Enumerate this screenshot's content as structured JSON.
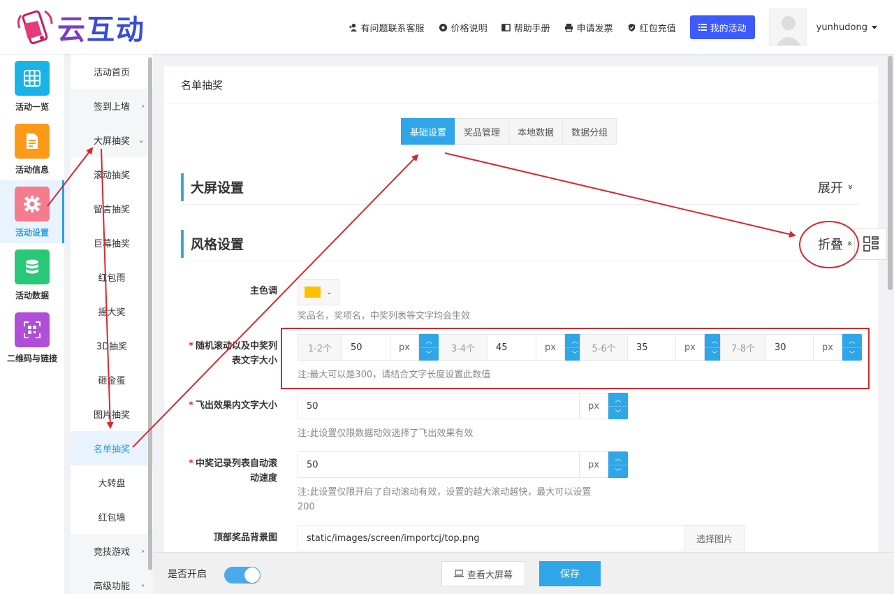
{
  "brand": {
    "logo_text_1": "云",
    "logo_text_2": "互动"
  },
  "top_nav": {
    "items": [
      {
        "label": "有问题联系客服",
        "icon": "add-user-icon"
      },
      {
        "label": "价格说明",
        "icon": "gear-icon"
      },
      {
        "label": "帮助手册",
        "icon": "book-icon"
      },
      {
        "label": "申请发票",
        "icon": "printer-icon"
      },
      {
        "label": "红包充值",
        "icon": "shield-check-icon"
      }
    ],
    "my_activity": "我的活动",
    "username": "yunhudong"
  },
  "iconbar": {
    "items": [
      {
        "label": "活动一览",
        "color": "#1ab3e8",
        "icon": "grid-icon"
      },
      {
        "label": "活动信息",
        "color": "#fd9a18",
        "icon": "document-icon"
      },
      {
        "label": "活动设置",
        "color": "#f47c8c",
        "icon": "gear-icon"
      },
      {
        "label": "活动数据",
        "color": "#28c878",
        "icon": "database-icon"
      },
      {
        "label": "二维码与链接",
        "color": "#b14ed8",
        "icon": "qrcode-icon"
      }
    ]
  },
  "submenu": {
    "items": [
      {
        "label": "活动首页",
        "arrow": ""
      },
      {
        "label": "签到上墙",
        "arrow": "›"
      },
      {
        "label": "大屏抽奖",
        "arrow": "⌄"
      },
      {
        "label": "滚动抽奖",
        "arrow": ""
      },
      {
        "label": "留言抽奖",
        "arrow": ""
      },
      {
        "label": "巨幕抽奖",
        "arrow": ""
      },
      {
        "label": "红包雨",
        "arrow": ""
      },
      {
        "label": "摇大奖",
        "arrow": ""
      },
      {
        "label": "3D抽奖",
        "arrow": ""
      },
      {
        "label": "砸金蛋",
        "arrow": ""
      },
      {
        "label": "图片抽奖",
        "arrow": ""
      },
      {
        "label": "名单抽奖",
        "arrow": ""
      },
      {
        "label": "大转盘",
        "arrow": ""
      },
      {
        "label": "红包墙",
        "arrow": ""
      },
      {
        "label": "竞技游戏",
        "arrow": "›"
      },
      {
        "label": "高级功能",
        "arrow": "›"
      }
    ]
  },
  "main": {
    "title": "名单抽奖",
    "tabs": [
      "基础设置",
      "奖品管理",
      "本地数据",
      "数据分组"
    ],
    "section_screen": {
      "title": "大屏设置",
      "toggle": "展开",
      "toggle_icon": "»"
    },
    "section_style": {
      "title": "风格设置",
      "toggle": "折叠",
      "toggle_icon": "»"
    },
    "primary_color": {
      "label": "主色调",
      "value": "#ffc000",
      "hint": "奖品名，奖项名，中奖列表等文字均会生效"
    },
    "random_font": {
      "req": "*",
      "label_l1": "随机滚动以及中奖列",
      "label_l2": "表文字大小",
      "groups": [
        {
          "prefix": "1-2个",
          "value": "50",
          "unit": "px"
        },
        {
          "prefix": "3-4个",
          "value": "45",
          "unit": "px"
        },
        {
          "prefix": "5-6个",
          "value": "35",
          "unit": "px"
        },
        {
          "prefix": "7-8个",
          "value": "30",
          "unit": "px"
        }
      ],
      "hint": "注:最大可以是300，请结合文字长度设置此数值"
    },
    "fly_font": {
      "req": "*",
      "label": "飞出效果内文字大小",
      "value": "50",
      "unit": "px",
      "hint": "注:此设置仅限数据动效选择了飞出效果有效"
    },
    "scroll_speed": {
      "req": "*",
      "label_l1": "中奖记录列表自动滚",
      "label_l2": "动速度",
      "value": "50",
      "unit": "px",
      "hint_l1": "注:此设置仅限开启了自动滚动有效，设置的越大滚动越快，最大可以设置",
      "hint_l2": "200"
    },
    "top_bg": {
      "label": "顶部奖品背景图",
      "value": "static/images/screen/importcj/top.png",
      "button": "选择图片"
    }
  },
  "bottom": {
    "enable_label": "是否开启",
    "enabled": true,
    "view_button": "查看大屏幕",
    "save_button": "保存"
  },
  "colors": {
    "accent": "#2ea6e8",
    "brand_button": "#3d5afe",
    "annotation": "#d9272e"
  }
}
